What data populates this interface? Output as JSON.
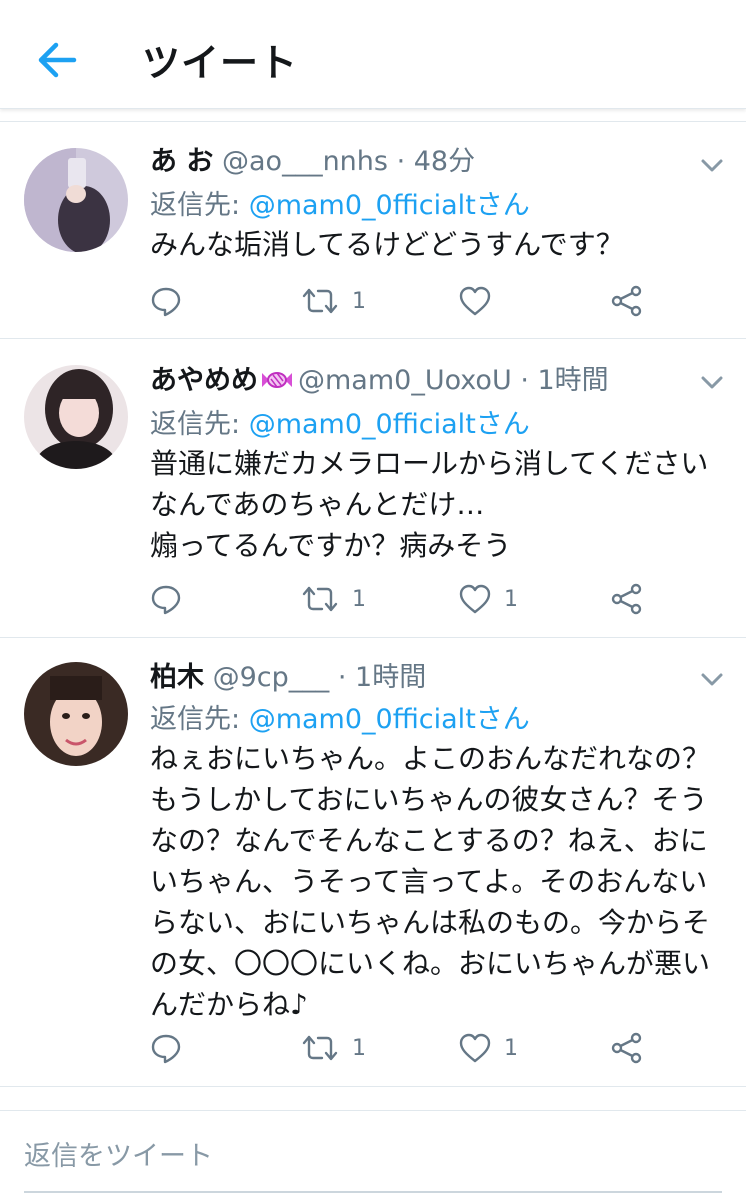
{
  "header": {
    "title": "ツイート",
    "back_icon": "arrow-left-icon",
    "accent": "#1da1f2"
  },
  "tweets": [
    {
      "name": "あ お",
      "handle": "@ao___nnhs",
      "separator": "·",
      "time": "48分",
      "reply_prefix": "返信先: ",
      "reply_mention": "@mam0_0fficialtさん",
      "text": "みんな垢消してるけどどうすんです？",
      "retweets": "1",
      "likes": ""
    },
    {
      "name": "あやめめ",
      "name_emoji": "candy-icon",
      "handle": "@mam0_UoxoU",
      "separator": "·",
      "time": "1時間",
      "reply_prefix": "返信先: ",
      "reply_mention": "@mam0_0fficialtさん",
      "text": "普通に嫌だカメラロールから消してください\nなんであのちゃんとだけ…\n煽ってるんですか？病みそう",
      "retweets": "1",
      "likes": "1"
    },
    {
      "name": "柏木",
      "handle": "@9cp___",
      "separator": "·",
      "time": "1時間",
      "reply_prefix": "返信先: ",
      "reply_mention": "@mam0_0fficialtさん",
      "text": "ねぇおにいちゃん。よこのおんなだれなの？\nもうしかしておにいちゃんの彼女さん？そう\nなの？なんでそんなことするの？ねえ、おに\nいちゃん、うそって言ってよ。そのおんない\nらない、おにいちゃんは私のもの。今からそ\nの女、〇〇〇にいくね。おにいちゃんが悪い\nんだからね♪",
      "retweets": "1",
      "likes": "1"
    }
  ],
  "compose": {
    "placeholder": "返信をツイート"
  },
  "colors": {
    "text": "#14171a",
    "secondary": "#657786",
    "link": "#1da1f2",
    "border": "#e1e8ed"
  }
}
